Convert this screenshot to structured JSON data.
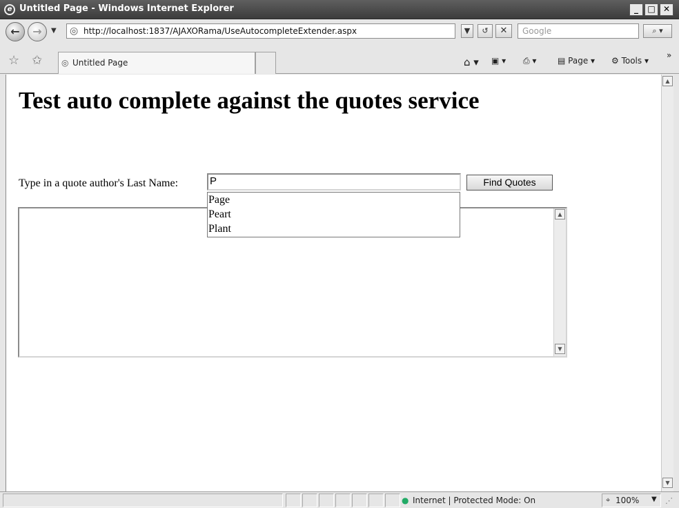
{
  "window": {
    "title": "Untitled Page - Windows Internet Explorer",
    "minimize": "_",
    "maximize": "□",
    "close": "✕"
  },
  "nav": {
    "url": "http://localhost:1837/AJAXORama/UseAutocompleteExtender.aspx",
    "search_placeholder": "Google",
    "back_icon": "back-arrow-icon",
    "forward_icon": "forward-arrow-icon"
  },
  "tabs": {
    "active_label": "Untitled Page"
  },
  "command_bar": {
    "page_label": "Page",
    "tools_label": "Tools"
  },
  "page": {
    "heading": "Test auto complete against the quotes service",
    "lastname_label": "Type in a quote author's Last Name:",
    "lastname_value": "P",
    "find_button": "Find Quotes",
    "suggestions": [
      "Page",
      "Peart",
      "Plant"
    ]
  },
  "status": {
    "zone": "Internet | Protected Mode: On",
    "zoom": "100%"
  }
}
